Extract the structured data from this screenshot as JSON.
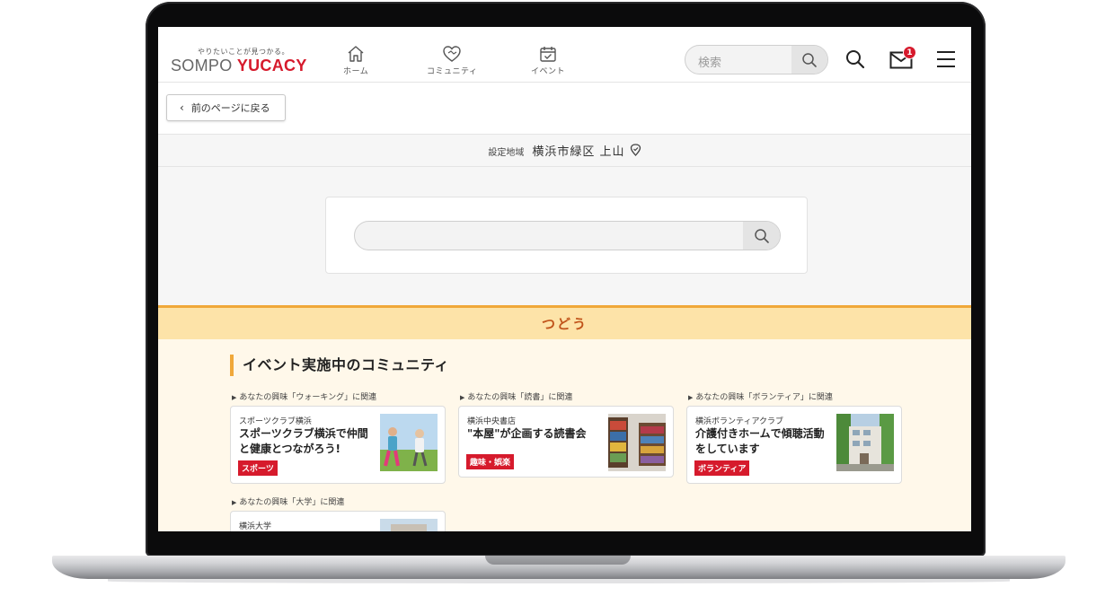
{
  "header": {
    "logo_tagline": "やりたいことが見つかる。",
    "logo_prefix": "SOMPO",
    "logo_brand": "YUCACY",
    "nav": [
      {
        "label": "ホーム",
        "icon": "home-icon"
      },
      {
        "label": "コミュニティ",
        "icon": "heart-community-icon"
      },
      {
        "label": "イベント",
        "icon": "calendar-check-icon"
      }
    ],
    "search_placeholder": "検索",
    "mail_badge": "1",
    "brand_color": "#d61a2c"
  },
  "back_button": {
    "label": "前のページに戻る"
  },
  "region": {
    "label": "設定地域",
    "value": "横浜市緑区 上山"
  },
  "tsudou_label": "つどう",
  "section_title": "イベント実施中のコミュニティ",
  "cards": [
    {
      "related": "あなたの興味「ウォーキング」に関連",
      "org": "スポーツクラブ横浜",
      "title": "スポーツクラブ横浜で仲間と健康とつながろう!",
      "tag": "スポーツ"
    },
    {
      "related": "あなたの興味「読書」に関連",
      "org": "横浜中央書店",
      "title": "\"本屋\"が企画する読書会",
      "tag": "趣味・娯楽"
    },
    {
      "related": "あなたの興味「ボランティア」に関連",
      "org": "横浜ボランティアクラブ",
      "title": "介護付きホームで傾聴活動をしています",
      "tag": "ボランティア"
    },
    {
      "related": "あなたの興味「大学」に関連",
      "org": "横浜大学",
      "title": "",
      "tag": ""
    }
  ]
}
